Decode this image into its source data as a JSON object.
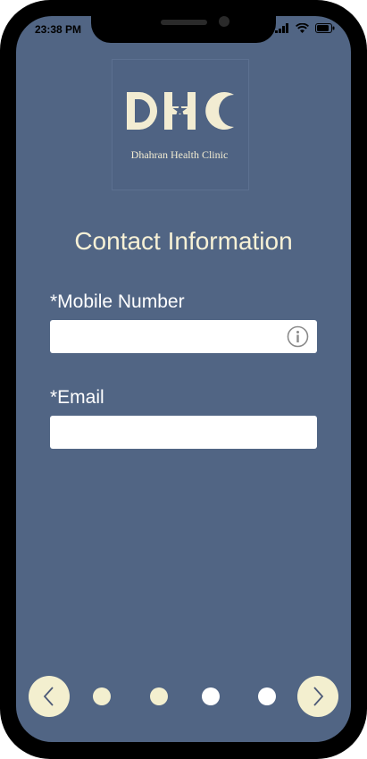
{
  "status_bar": {
    "time": "23:38 PM",
    "icons": [
      "signal-bars-icon",
      "wifi-icon",
      "battery-icon"
    ]
  },
  "logo": {
    "letters": "DHC",
    "subtitle": "Dhahran Health Clinic"
  },
  "page": {
    "title": "Contact Information"
  },
  "form": {
    "mobile": {
      "label": "*Mobile Number",
      "value": "",
      "placeholder": "",
      "info_icon": "info-circle-icon"
    },
    "email": {
      "label": "*Email",
      "value": "",
      "placeholder": ""
    }
  },
  "pagination": {
    "prev_icon": "chevron-left-icon",
    "next_icon": "chevron-right-icon",
    "total_steps": 4,
    "active_steps": 2
  },
  "colors": {
    "background": "#516584",
    "accent": "#f3efcf",
    "title_text": "#f7f1d6",
    "label_text": "#ffffff",
    "dot_inactive": "#ffffff"
  }
}
